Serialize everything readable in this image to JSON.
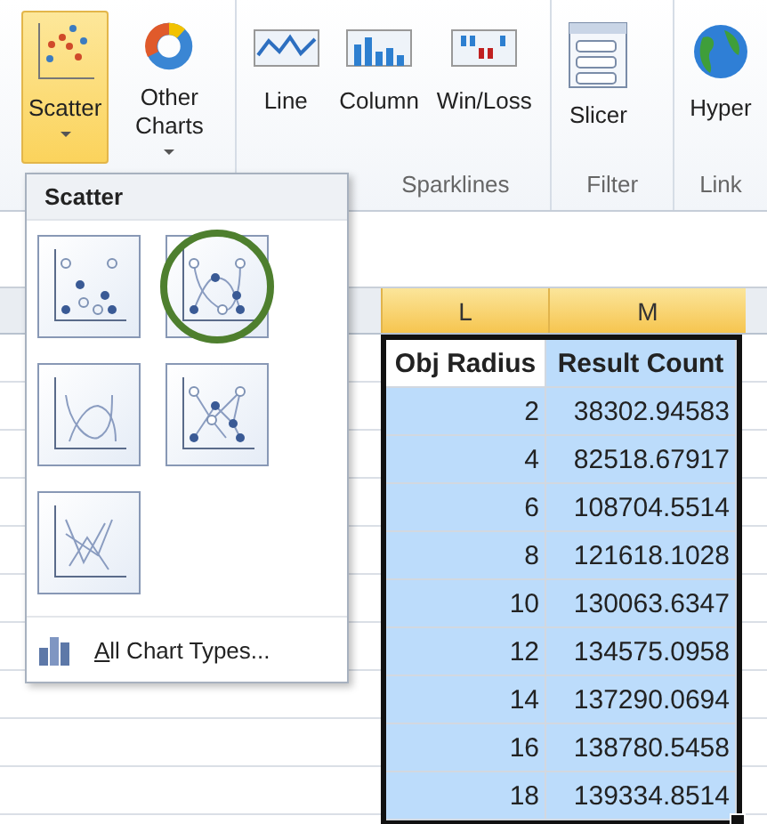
{
  "ribbon": {
    "groups": [
      {
        "buttons": [
          {
            "kind": "scatter",
            "label": "Scatter",
            "dropdown": true,
            "selected": true
          },
          {
            "kind": "donut",
            "label": "Other Charts",
            "dropdown": true,
            "selected": false
          }
        ]
      },
      {
        "label": "Sparklines",
        "buttons": [
          {
            "kind": "line",
            "label": "Line",
            "dropdown": false,
            "selected": false
          },
          {
            "kind": "column",
            "label": "Column",
            "dropdown": false,
            "selected": false
          },
          {
            "kind": "winloss",
            "label": "Win/Loss",
            "dropdown": false,
            "selected": false
          }
        ]
      },
      {
        "label": "Filter",
        "buttons": [
          {
            "kind": "slicer",
            "label": "Slicer",
            "dropdown": false,
            "selected": false
          }
        ]
      },
      {
        "label": "Link",
        "buttons": [
          {
            "kind": "globe",
            "label": "Hyper",
            "dropdown": false,
            "selected": false
          }
        ]
      }
    ]
  },
  "menu": {
    "title": "Scatter",
    "items": [
      {
        "kind": "markers",
        "circled": false
      },
      {
        "kind": "smooth-markers",
        "circled": true
      },
      {
        "kind": "smooth",
        "circled": false
      },
      {
        "kind": "straight-markers",
        "circled": false
      },
      {
        "kind": "straight",
        "circled": false
      }
    ],
    "footer": "All Chart Types..."
  },
  "sheet": {
    "columns": [
      {
        "label": "L",
        "selected": true
      },
      {
        "label": "M",
        "selected": true
      }
    ],
    "header": [
      "Obj Radius",
      "Result Count"
    ],
    "rows": [
      [
        "2",
        "38302.94583"
      ],
      [
        "4",
        "82518.67917"
      ],
      [
        "6",
        "108704.5514"
      ],
      [
        "8",
        "121618.1028"
      ],
      [
        "10",
        "130063.6347"
      ],
      [
        "12",
        "134575.0958"
      ],
      [
        "14",
        "137290.0694"
      ],
      [
        "16",
        "138780.5458"
      ],
      [
        "18",
        "139334.8514"
      ]
    ]
  }
}
